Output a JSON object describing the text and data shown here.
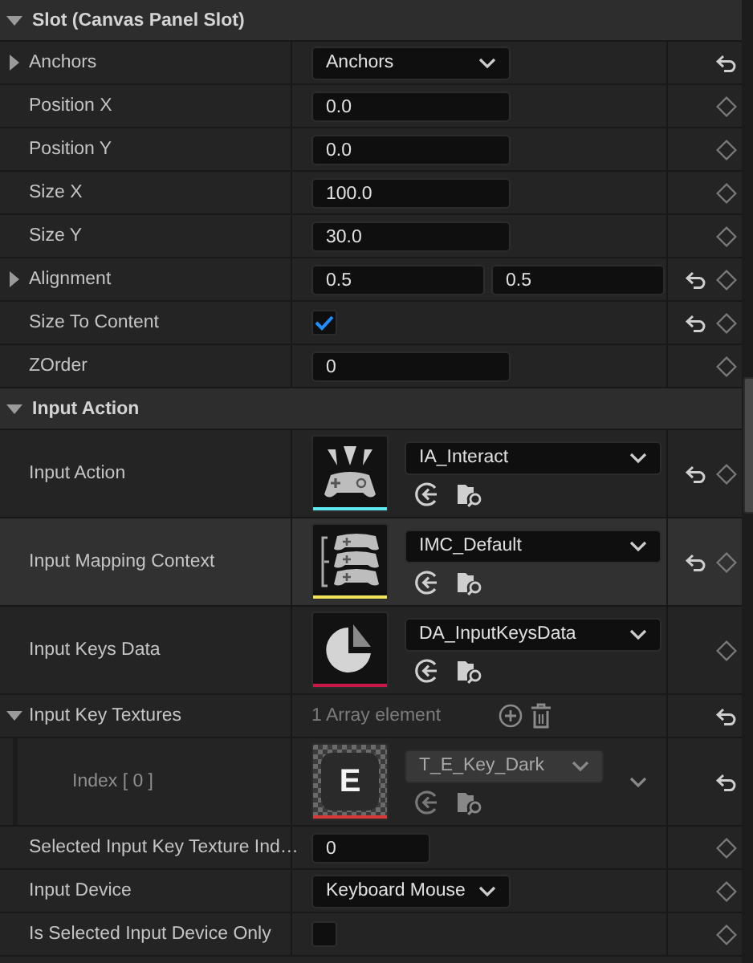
{
  "sections": [
    {
      "title": "Slot (Canvas Panel Slot)",
      "expanded": true,
      "rows": [
        {
          "kind": "dropdown",
          "label": "Anchors",
          "expanded": false,
          "value": "Anchors",
          "reset": true,
          "keyable": false,
          "hovered": false
        },
        {
          "kind": "number",
          "label": "Position X",
          "values": [
            "0.0"
          ],
          "reset": false,
          "keyable": true,
          "hovered": false
        },
        {
          "kind": "number",
          "label": "Position Y",
          "values": [
            "0.0"
          ],
          "reset": false,
          "keyable": true,
          "hovered": false
        },
        {
          "kind": "number",
          "label": "Size X",
          "values": [
            "100.0"
          ],
          "reset": false,
          "keyable": true,
          "hovered": false
        },
        {
          "kind": "number",
          "label": "Size Y",
          "values": [
            "30.0"
          ],
          "reset": false,
          "keyable": true,
          "hovered": false
        },
        {
          "kind": "number",
          "label": "Alignment",
          "expanded": false,
          "values": [
            "0.5",
            "0.5"
          ],
          "reset": true,
          "keyable": true,
          "hovered": false
        },
        {
          "kind": "checkbox",
          "label": "Size To Content",
          "checked": true,
          "reset": true,
          "keyable": true,
          "hovered": false
        },
        {
          "kind": "number",
          "label": "ZOrder",
          "values": [
            "0"
          ],
          "reset": false,
          "keyable": true,
          "hovered": false
        }
      ]
    },
    {
      "title": "Input Action",
      "expanded": true,
      "rows": [
        {
          "kind": "asset",
          "label": "Input Action",
          "thumbnail": {
            "kind": "gamepad",
            "color": "#5ee8f0"
          },
          "value": "IA_Interact",
          "disabled": false,
          "reset": true,
          "keyable": true,
          "hovered": false
        },
        {
          "kind": "asset",
          "label": "Input Mapping Context",
          "thumbnail": {
            "kind": "mapping",
            "color": "#f0e45a"
          },
          "value": "IMC_Default",
          "disabled": false,
          "reset": true,
          "keyable": true,
          "hovered": true
        },
        {
          "kind": "asset",
          "label": "Input Keys Data",
          "thumbnail": {
            "kind": "pie",
            "color": "#c81848"
          },
          "value": "DA_InputKeysData",
          "disabled": false,
          "reset": false,
          "keyable": true,
          "hovered": false
        },
        {
          "kind": "array",
          "label": "Input Key Textures",
          "expanded": true,
          "count": "1 Array element",
          "reset": true,
          "keyable": false,
          "hovered": false,
          "children": [
            {
              "kind": "asset",
              "label": "Index [ 0 ]",
              "thumbnail": {
                "kind": "key",
                "text": "E",
                "color": "#d83a3a"
              },
              "value": "T_E_Key_Dark",
              "disabled": true,
              "reset": true,
              "keyable": false,
              "hovered": false
            }
          ]
        },
        {
          "kind": "int",
          "label": "Selected Input Key Texture Ind…",
          "values": [
            "0"
          ],
          "reset": false,
          "keyable": true,
          "hovered": false
        },
        {
          "kind": "dropdown",
          "label": "Input Device",
          "value": "Keyboard Mouse",
          "reset": false,
          "keyable": true,
          "hovered": false
        },
        {
          "kind": "checkbox",
          "label": "Is Selected Input Device Only",
          "checked": false,
          "reset": false,
          "keyable": true,
          "hovered": false
        }
      ]
    }
  ]
}
